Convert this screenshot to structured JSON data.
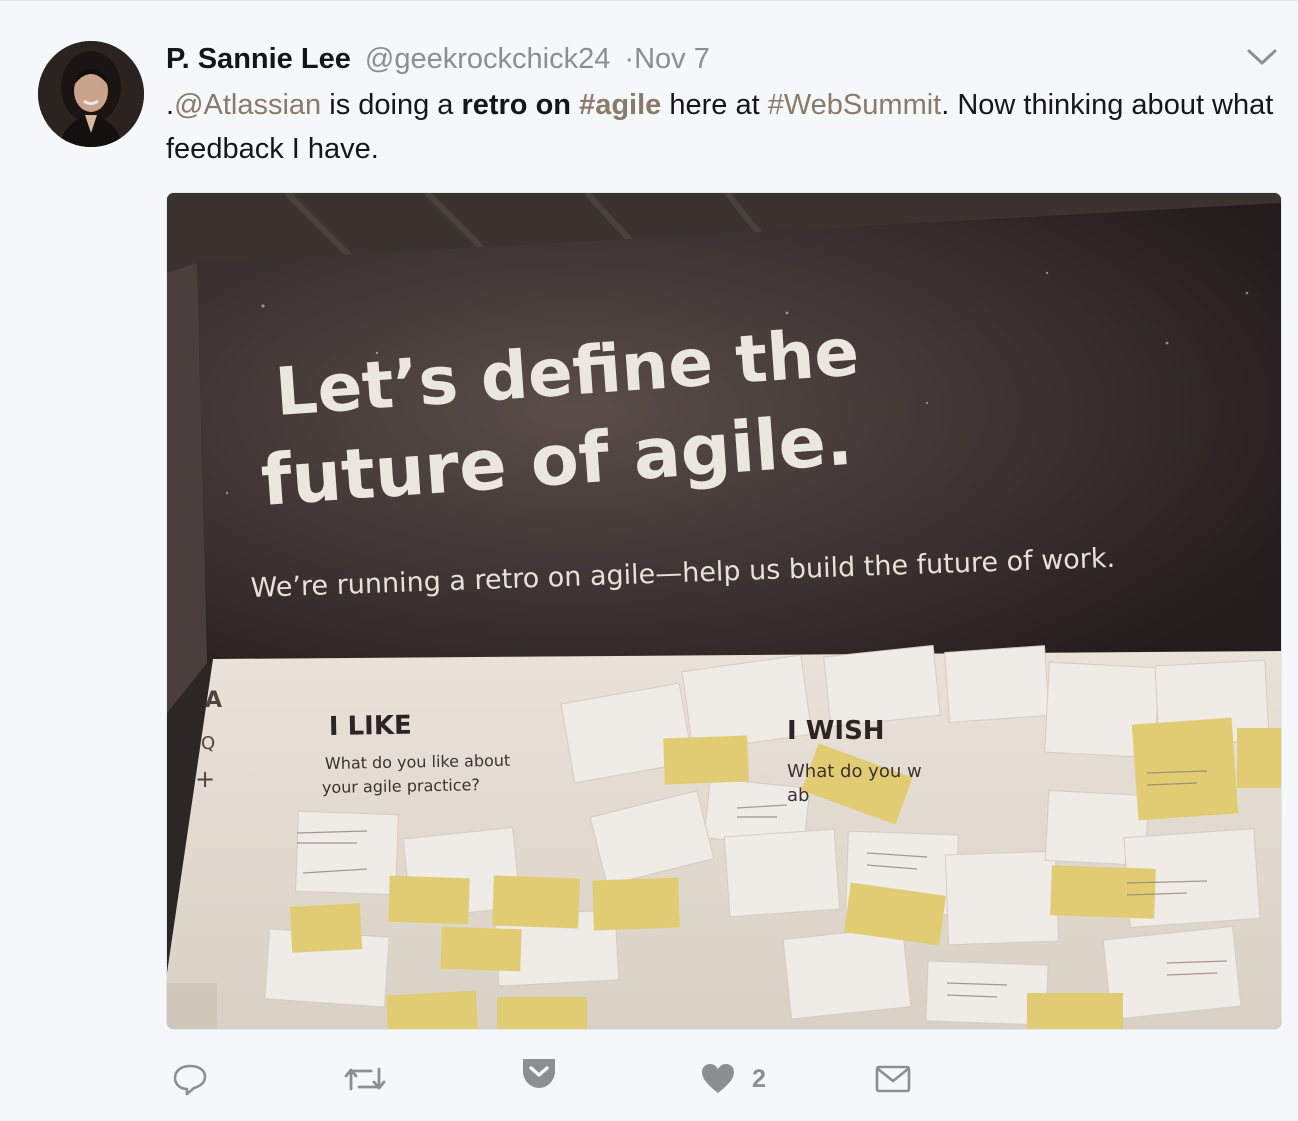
{
  "tweet": {
    "author": {
      "name": "P. Sannie Lee",
      "handle": "@geekrockchick24",
      "timestamp": "·Nov 7"
    },
    "text": {
      "prefix": ".",
      "mention": "@Atlassian",
      "part1": " is doing a ",
      "bold1": "retro on",
      "space": " ",
      "hashtag1": "#agile",
      "part2": " here at ",
      "hashtag2": "#WebSummit",
      "part3": ". Now thinking about what feedback I have."
    },
    "media": {
      "headline_line1": "Let’s define the",
      "headline_line2": "future of agile.",
      "subline": "We’re running a retro on agile—help us build the future of work.",
      "board": {
        "like_title": "I LIKE",
        "like_line1": "What do you like about",
        "like_line2": "your agile practice?",
        "wish_title": "I WISH",
        "wish_line1": "What do you w",
        "wish_line2": "ab",
        "sidebar_logo": "A",
        "sidebar_search": "Q",
        "sidebar_plus": "+"
      }
    },
    "actions": {
      "like_count": "2"
    },
    "icons": {
      "caret": "chevron-down-icon",
      "reply": "reply-icon",
      "retweet": "retweet-icon",
      "pocket": "pocket-icon",
      "like": "heart-icon",
      "dm": "envelope-icon"
    },
    "colors": {
      "link": "#8b7a68",
      "muted": "#8a8f94",
      "background": "#f5f8fa"
    }
  }
}
